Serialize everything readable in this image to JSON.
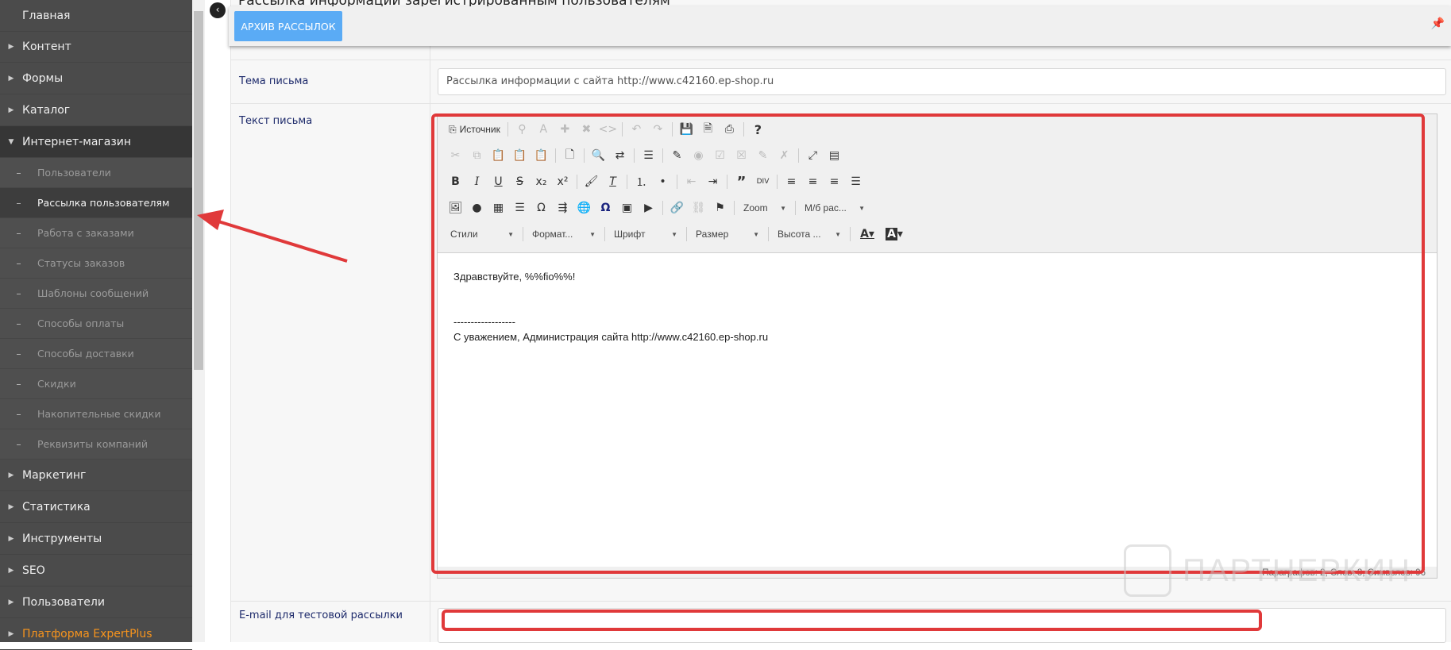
{
  "sidebar": {
    "items": [
      {
        "label": "Главная"
      },
      {
        "label": "Контент"
      },
      {
        "label": "Формы"
      },
      {
        "label": "Каталог"
      },
      {
        "label": "Интернет-магазин"
      }
    ],
    "subitems": [
      {
        "label": "Пользователи"
      },
      {
        "label": "Рассылка пользователям"
      },
      {
        "label": "Работа с заказами"
      },
      {
        "label": "Статусы заказов"
      },
      {
        "label": "Шаблоны сообщений"
      },
      {
        "label": "Способы оплаты"
      },
      {
        "label": "Способы доставки"
      },
      {
        "label": "Скидки"
      },
      {
        "label": "Накопительные скидки"
      },
      {
        "label": "Реквизиты компаний"
      }
    ],
    "items_after": [
      {
        "label": "Маркетинг"
      },
      {
        "label": "Статистика"
      },
      {
        "label": "Инструменты"
      },
      {
        "label": "SEO"
      },
      {
        "label": "Пользователи"
      },
      {
        "label": "Платформа ExpertPlus"
      }
    ]
  },
  "page": {
    "title": "Рассылка информации зарегистрированным пользователям"
  },
  "toolbar": {
    "archive_label": "АРХИВ РАССЫЛОК"
  },
  "form": {
    "subject_label": "Тема письма",
    "subject_value": "Рассылка информации с сайта http://www.c42160.ep-shop.ru",
    "body_label": "Текст письма",
    "email_label": "E-mail для тестовой рассылки",
    "email_value": ""
  },
  "editor": {
    "source_label": "Источник",
    "combos": {
      "zoom": "Zoom",
      "line_spacing": "М/б рас...",
      "styles": "Стили",
      "format": "Формат...",
      "font": "Шрифт",
      "size": "Размер",
      "height": "Высота ..."
    },
    "content": {
      "line1": "Здравствуйте, %%fio%%!",
      "line2": "------------------",
      "line3": "С уважением, Администрация сайта http://www.c42160.ep-shop.ru"
    },
    "status": "Параграфов: 2, Слов: 8, Символов: 96"
  },
  "watermark": "ПАРТНЕРКИН",
  "colors": {
    "accent": "#5aabf5",
    "annotation": "#e0393a",
    "sidebar": "#4b4b4b",
    "highlight": "#f7941d"
  }
}
